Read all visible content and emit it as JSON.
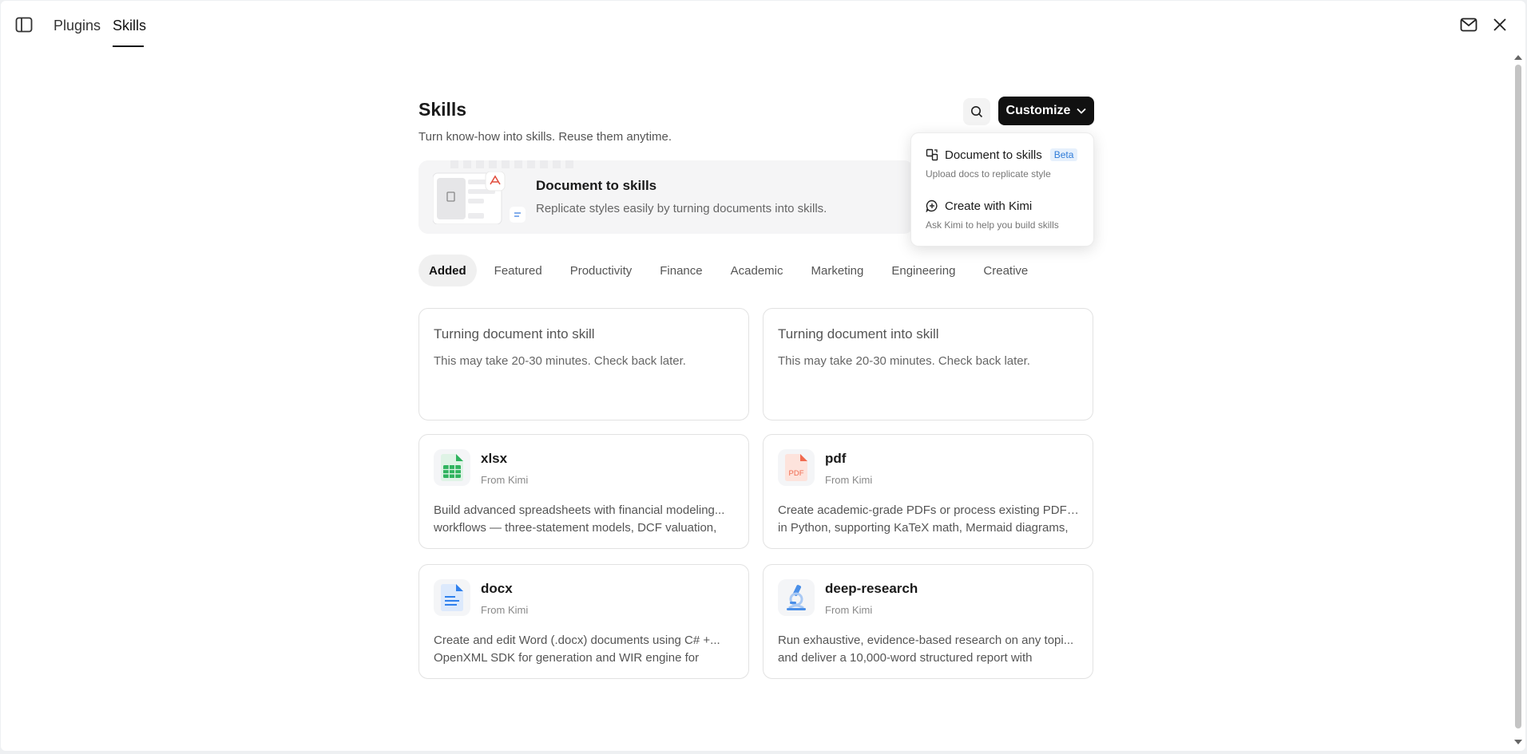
{
  "topbar": {
    "tabs": [
      {
        "label": "Plugins"
      },
      {
        "label": "Skills"
      }
    ]
  },
  "page": {
    "title": "Skills",
    "subtitle": "Turn know-how into skills. Reuse them anytime."
  },
  "toolbar": {
    "customize_label": "Customize"
  },
  "banner": {
    "title": "Document to skills",
    "description": "Replicate styles easily by turning documents into skills."
  },
  "dropdown": {
    "items": [
      {
        "label": "Document to skills",
        "badge": "Beta",
        "description": "Upload docs to replicate style"
      },
      {
        "label": "Create with Kimi",
        "description": "Ask Kimi to help you build skills"
      }
    ]
  },
  "categories": [
    "Added",
    "Featured",
    "Productivity",
    "Finance",
    "Academic",
    "Marketing",
    "Engineering",
    "Creative"
  ],
  "pending_cards": [
    {
      "title": "Turning document into skill",
      "description": "This may take 20-30 minutes. Check back later."
    },
    {
      "title": "Turning document into skill",
      "description": "This may take 20-30 minutes. Check back later."
    }
  ],
  "skills": [
    {
      "name": "xlsx",
      "from": "From Kimi",
      "line1": "Build advanced spreadsheets with financial modeling...",
      "line2": "workflows — three-statement models, DCF valuation,",
      "icon": "spreadsheet-icon",
      "color": "#2fb35e"
    },
    {
      "name": "pdf",
      "from": "From Kimi",
      "line1": "Create academic-grade PDFs or process existing PDFs...",
      "line2": "in Python, supporting KaTeX math, Mermaid diagrams,",
      "icon": "pdf-file-icon",
      "icon_text": "PDF",
      "color": "#f06a4f"
    },
    {
      "name": "docx",
      "from": "From Kimi",
      "line1": "Create and edit Word (.docx) documents using C# +...",
      "line2": "OpenXML SDK for generation and WIR engine for",
      "icon": "word-document-icon",
      "color": "#2f80ed"
    },
    {
      "name": "deep-research",
      "from": "From Kimi",
      "line1": "Run exhaustive, evidence-based research on any topi...",
      "line2": "and deliver a 10,000-word structured report with",
      "icon": "microscope-icon",
      "color": "#4a8fe8"
    }
  ]
}
